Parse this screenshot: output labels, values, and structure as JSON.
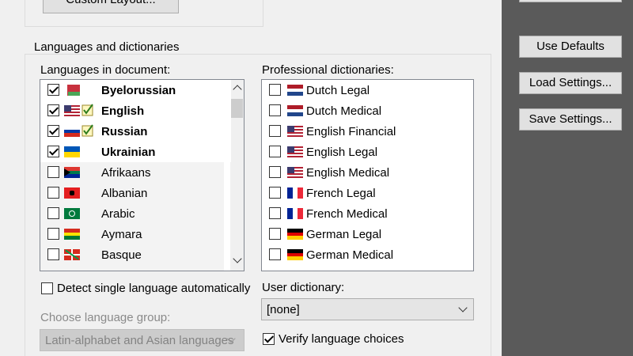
{
  "top": {
    "custom_layout_label": "Custom Layout..."
  },
  "side_buttons": {
    "use_defaults": "Use Defaults",
    "load_settings": "Load Settings...",
    "save_settings": "Save Settings..."
  },
  "group": {
    "title": "Languages and dictionaries",
    "languages_label": "Languages in document:",
    "languages": [
      {
        "name": "Byelorussian",
        "checked": true,
        "bold": true,
        "verified": false,
        "flag": "belarus-flag"
      },
      {
        "name": "English",
        "checked": true,
        "bold": true,
        "verified": true,
        "flag": "us-flag"
      },
      {
        "name": "Russian",
        "checked": true,
        "bold": true,
        "verified": true,
        "flag": "russia-flag"
      },
      {
        "name": "Ukrainian",
        "checked": true,
        "bold": true,
        "verified": false,
        "flag": "ukraine-flag"
      },
      {
        "name": "Afrikaans",
        "checked": false,
        "bold": false,
        "verified": false,
        "flag": "south-africa-flag"
      },
      {
        "name": "Albanian",
        "checked": false,
        "bold": false,
        "verified": false,
        "flag": "albania-flag"
      },
      {
        "name": "Arabic",
        "checked": false,
        "bold": false,
        "verified": false,
        "flag": "arabic-flag"
      },
      {
        "name": "Aymara",
        "checked": false,
        "bold": false,
        "verified": false,
        "flag": "bolivia-flag"
      },
      {
        "name": "Basque",
        "checked": false,
        "bold": false,
        "verified": false,
        "flag": "basque-flag"
      }
    ],
    "dictionaries_label": "Professional dictionaries:",
    "dictionaries": [
      {
        "name": "Dutch Legal",
        "checked": false,
        "flag": "netherlands-flag"
      },
      {
        "name": "Dutch Medical",
        "checked": false,
        "flag": "netherlands-flag"
      },
      {
        "name": "English Financial",
        "checked": false,
        "flag": "us-flag"
      },
      {
        "name": "English Legal",
        "checked": false,
        "flag": "us-flag"
      },
      {
        "name": "English Medical",
        "checked": false,
        "flag": "us-flag"
      },
      {
        "name": "French Legal",
        "checked": false,
        "flag": "france-flag"
      },
      {
        "name": "French Medical",
        "checked": false,
        "flag": "france-flag"
      },
      {
        "name": "German Legal",
        "checked": false,
        "flag": "germany-flag"
      },
      {
        "name": "German Medical",
        "checked": false,
        "flag": "germany-flag"
      }
    ],
    "detect_single_label": "Detect single language automatically",
    "detect_single_checked": false,
    "choose_group_label": "Choose language group:",
    "language_group_value": "Latin-alphabet and Asian languages",
    "user_dictionary_label": "User dictionary:",
    "user_dictionary_value": "[none]",
    "verify_label": "Verify language choices",
    "verify_checked": true
  }
}
